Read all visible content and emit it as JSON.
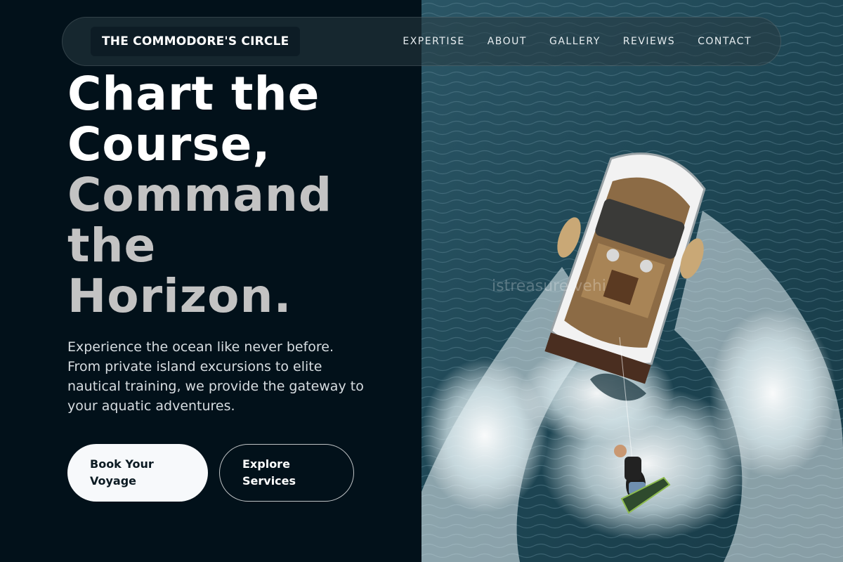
{
  "brand": {
    "name": "THE COMMODORE'S CIRCLE"
  },
  "nav": {
    "items": [
      {
        "label": "EXPERTISE"
      },
      {
        "label": "ABOUT"
      },
      {
        "label": "GALLERY"
      },
      {
        "label": "REVIEWS"
      },
      {
        "label": "CONTACT"
      }
    ]
  },
  "hero": {
    "headline_lines": [
      "Chart the",
      "Course,",
      "Command",
      "the",
      "Horizon."
    ],
    "description": "Experience the ocean like never before. From private island excursions to elite nautical training, we provide the gateway to your aquatic adventures.",
    "primary_button": "Book Your Voyage",
    "secondary_button": "Explore Services",
    "photo_watermark": "istreasure.vehi"
  },
  "colors": {
    "background": "#02111a",
    "primary_button_bg": "#f7f9fb",
    "headline_grey": "#c3c3c3",
    "water": "#1f4a5a"
  }
}
